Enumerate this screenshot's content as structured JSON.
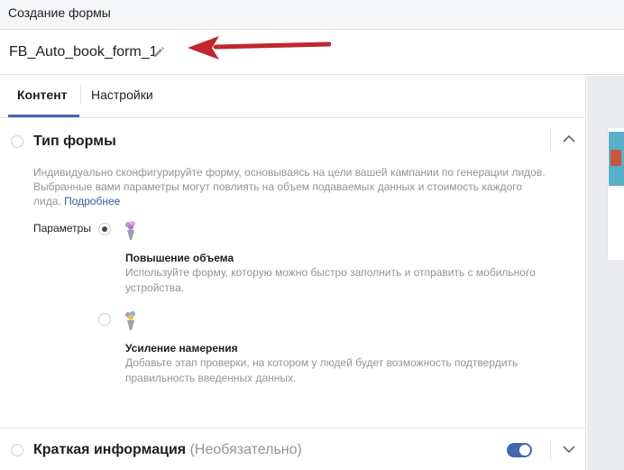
{
  "header": {
    "title": "Создание формы"
  },
  "form": {
    "name": "FB_Auto_book_form_1"
  },
  "tabs": [
    {
      "label": "Контент",
      "active": true
    },
    {
      "label": "Настройки",
      "active": false
    }
  ],
  "form_type_section": {
    "title": "Тип формы",
    "description": "Индивидуально сконфигурируйте форму, основываясь на цели вашей кампании по генерации лидов. Выбранные вами параметры могут повлиять на объем подаваемых данных и стоимость каждого лида.",
    "more_link": "Подробнее",
    "params_label": "Параметры",
    "options": [
      {
        "title": "Повышение объема",
        "description": "Используйте форму, которую можно быстро заполнить и отправить с мобильного устройства.",
        "selected": true,
        "icon": "bouquet-icon"
      },
      {
        "title": "Усиление намерения",
        "description": "Добавьте этап проверки, на котором у людей будет возможность подтвердить правильность введенных данных.",
        "selected": false,
        "icon": "bouquet-icon"
      }
    ]
  },
  "intro_section": {
    "title": "Краткая информация",
    "optional_label": "(Необязательно)",
    "enabled": true
  },
  "colors": {
    "accent": "#4267b2",
    "link": "#385898",
    "arrow": "#c0272d"
  }
}
